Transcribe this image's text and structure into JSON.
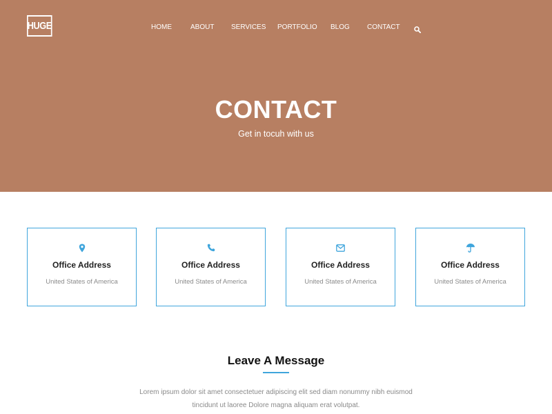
{
  "header": {
    "logo": "HUGE",
    "nav": [
      {
        "label": "HOME"
      },
      {
        "label": "ABOUT"
      },
      {
        "label": "SERVICES"
      },
      {
        "label": "PORTFOLIO"
      },
      {
        "label": "BLOG"
      },
      {
        "label": "CONTACT"
      }
    ],
    "search_icon": "search-icon"
  },
  "hero": {
    "title": "CONTACT",
    "subtitle": "Get in tocuh with us",
    "background": "#b77f62"
  },
  "cards": [
    {
      "icon": "map-marker-icon",
      "title": "Office Address",
      "text": "United States of America"
    },
    {
      "icon": "phone-icon",
      "title": "Office Address",
      "text": "United States of America"
    },
    {
      "icon": "envelope-icon",
      "title": "Office Address",
      "text": "United States of America"
    },
    {
      "icon": "umbrella-icon",
      "title": "Office Address",
      "text": "United States of America"
    }
  ],
  "message_section": {
    "title": "Leave A Message",
    "text": "Lorem ipsum dolor sit amet consectetuer adipiscing elit sed diam nonummy nibh euismod tincidunt ut laoree Dolore magna aliquam erat volutpat."
  },
  "colors": {
    "accent": "#3fa5dc",
    "hero_bg": "#b77f62",
    "heading": "#222222",
    "muted": "#8a8a8a"
  }
}
